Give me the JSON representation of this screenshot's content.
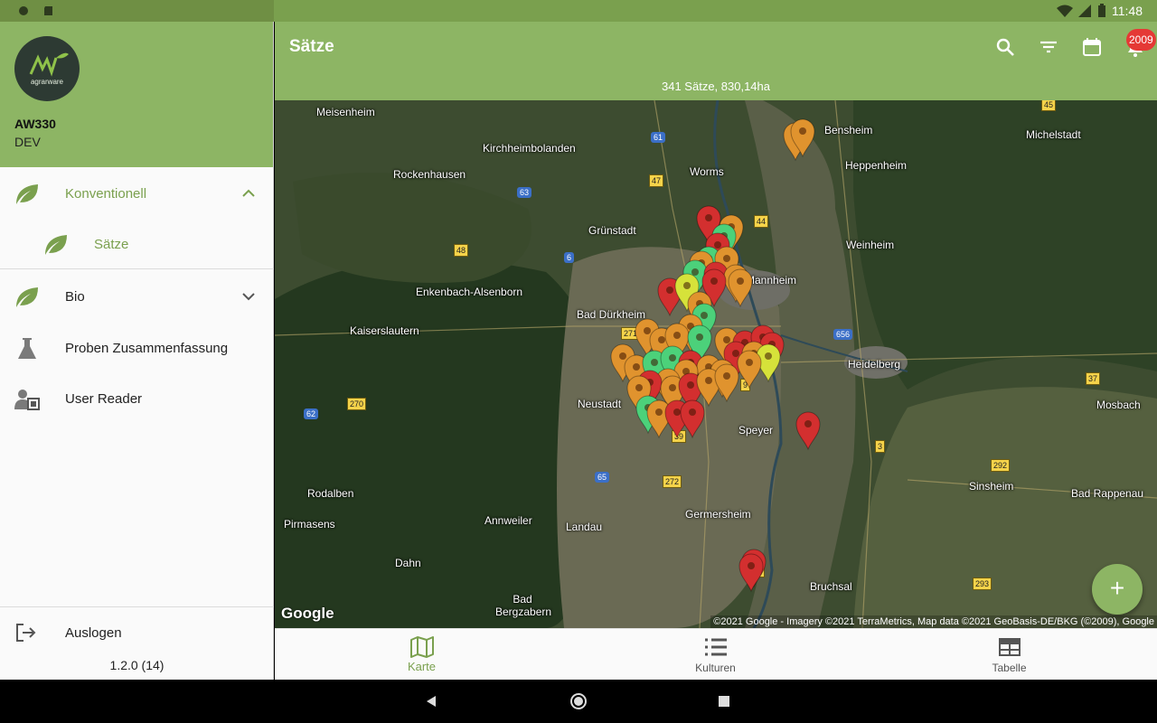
{
  "status_bar": {
    "time": "11:48"
  },
  "drawer": {
    "logo_text": "agrarware",
    "account_name": "AW330",
    "account_sub": "DEV",
    "items": [
      {
        "label": "Konventionell",
        "icon": "leaf-icon",
        "expanded": true
      },
      {
        "label": "Sätze",
        "icon": "leaf-icon",
        "selected": true
      },
      {
        "label": "Bio",
        "icon": "leaf-icon",
        "expanded": false
      },
      {
        "label": "Proben Zusammenfassung",
        "icon": "flask-icon"
      },
      {
        "label": "User Reader",
        "icon": "user-card-icon"
      }
    ],
    "logout_label": "Auslogen",
    "version": "1.2.0 (14)"
  },
  "appbar": {
    "title": "Sätze",
    "subtitle": "341 Sätze, 830,14ha",
    "notification_count": "2009",
    "actions": [
      "search-icon",
      "filter-icon",
      "calendar-icon",
      "bell-icon"
    ]
  },
  "map": {
    "places": [
      "Meisenheim",
      "Kirchheimbolanden",
      "Rockenhausen",
      "Worms",
      "Bensheim",
      "Heppenheim",
      "Michelstadt",
      "Grünstadt",
      "Weinheim",
      "Enkenbach-Alsenborn",
      "Mannheim",
      "Bad Dürkheim",
      "Kaiserslautern",
      "Heidelberg",
      "Neustadt",
      "Speyer",
      "Mosbach",
      "Sinsheim",
      "Bad Rappenau",
      "Rodalben",
      "Pirmasens",
      "Annweiler",
      "Landau",
      "Germersheim",
      "Dahn",
      "Bad Bergzabern",
      "Bruchsal"
    ],
    "roads": [
      "61",
      "47",
      "63",
      "44",
      "48",
      "6",
      "45",
      "656",
      "271",
      "9",
      "37",
      "270",
      "62",
      "39",
      "3",
      "292",
      "65",
      "272",
      "6",
      "293"
    ],
    "google_label": "Google",
    "attribution": "©2021 Google - Imagery ©2021 TerraMetrics, Map data ©2021 GeoBasis-DE/BKG (©2009), Google",
    "marker_colors": {
      "red": "#d32f2f",
      "orange": "#e0932e",
      "green": "#4cd17a",
      "yellow": "#d6e23a"
    }
  },
  "fab_label": "+",
  "bottom_nav": [
    {
      "label": "Karte",
      "icon": "map-icon",
      "active": true
    },
    {
      "label": "Kulturen",
      "icon": "list-icon",
      "active": false
    },
    {
      "label": "Tabelle",
      "icon": "table-icon",
      "active": false
    }
  ],
  "colors": {
    "primary": "#8db564",
    "primary_dark": "#6f8f44",
    "accent_text": "#7aa04e"
  }
}
